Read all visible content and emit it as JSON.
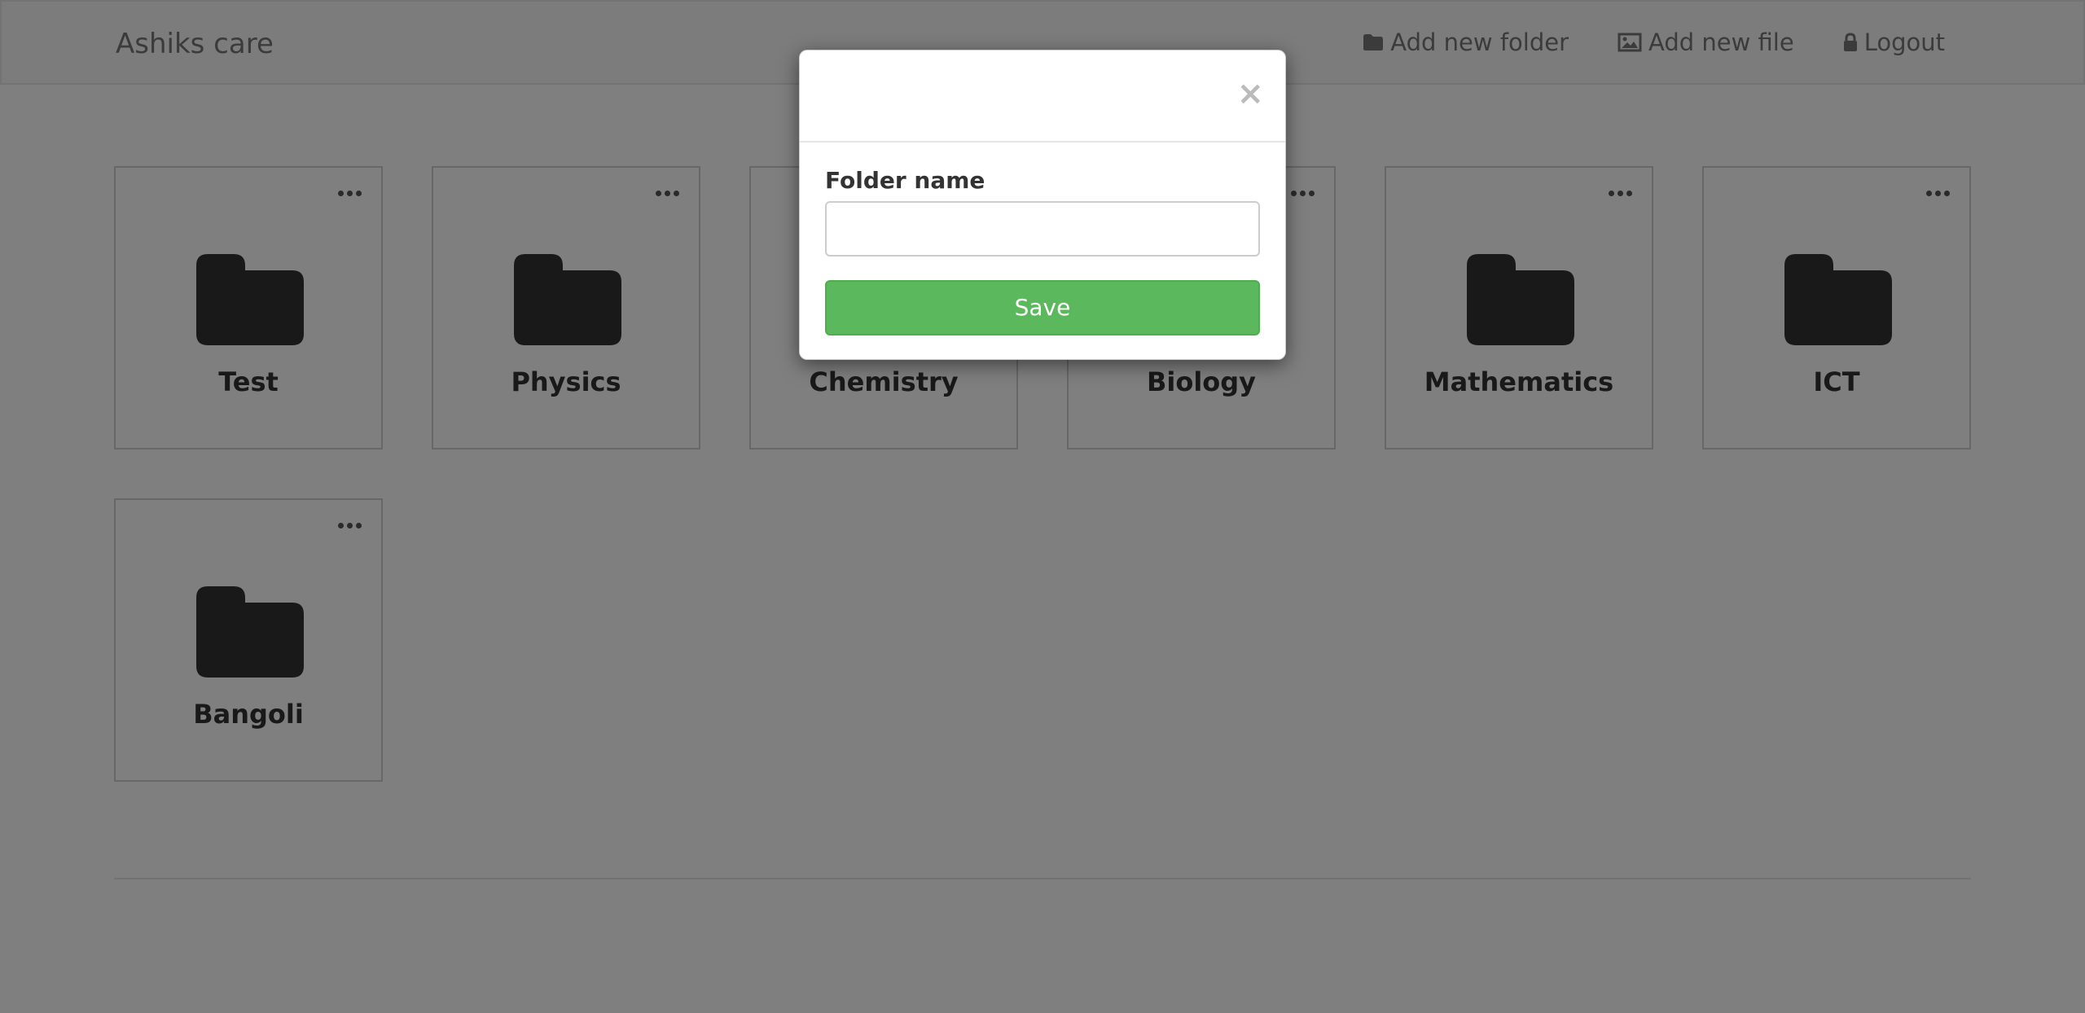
{
  "navbar": {
    "brand": "Ashiks care",
    "links": [
      {
        "label": "Add new folder",
        "icon": "folder-icon"
      },
      {
        "label": "Add new file",
        "icon": "image-icon"
      },
      {
        "label": "Logout",
        "icon": "lock-icon"
      }
    ]
  },
  "folders": [
    {
      "name": "Test"
    },
    {
      "name": "Physics"
    },
    {
      "name": "Chemistry"
    },
    {
      "name": "Biology"
    },
    {
      "name": "Mathematics"
    },
    {
      "name": "ICT"
    },
    {
      "name": "Bangoli"
    }
  ],
  "modal": {
    "close_label": "×",
    "field_label": "Folder name",
    "input_value": "",
    "save_label": "Save"
  },
  "colors": {
    "save_button": "#5cb85c",
    "folder_icon": "#333333",
    "backdrop": "rgba(0,0,0,0.5)"
  }
}
